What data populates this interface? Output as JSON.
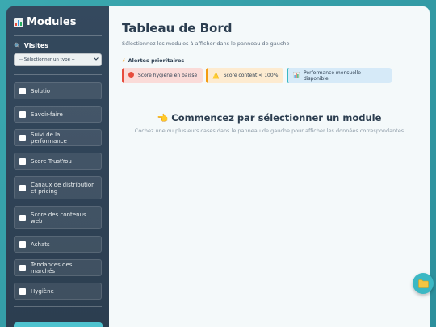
{
  "sidebar": {
    "title": "Modules",
    "visites_label": "Visites",
    "select_value": "-- Sélectionner un type --",
    "items": [
      {
        "label": "Solutio"
      },
      {
        "label": "Savoir-faire"
      },
      {
        "label": "Suivi de la performance"
      },
      {
        "label": "Score TrustYou"
      },
      {
        "label": "Canaux de distribution et pricing"
      },
      {
        "label": "Score des contenus web"
      },
      {
        "label": "Achats"
      },
      {
        "label": "Tendances des marchés"
      },
      {
        "label": "Hygiène"
      }
    ]
  },
  "main": {
    "title": "Tableau de Bord",
    "subtitle": "Sélectionnez les modules à afficher dans le panneau de gauche",
    "alerts_title": "Alertes prioritaires",
    "alerts": [
      {
        "label": "Score hygiène en baisse",
        "icon": "red-circle-icon"
      },
      {
        "label": "Score content < 100%",
        "icon": "warning-icon"
      },
      {
        "label": "Performance mensuelle disponible",
        "icon": "chart-icon"
      }
    ],
    "empty_title": "Commencez par sélectionner un module",
    "empty_subtitle": "Cochez une ou plusieurs cases dans le panneau de gauche pour afficher les données correspondantes"
  },
  "colors": {
    "background": "#3ba9b0",
    "sidebar": "#2c3e50",
    "accent": "#3bb8c4",
    "alert_red": "#e74c3c",
    "alert_orange": "#f39c12"
  }
}
